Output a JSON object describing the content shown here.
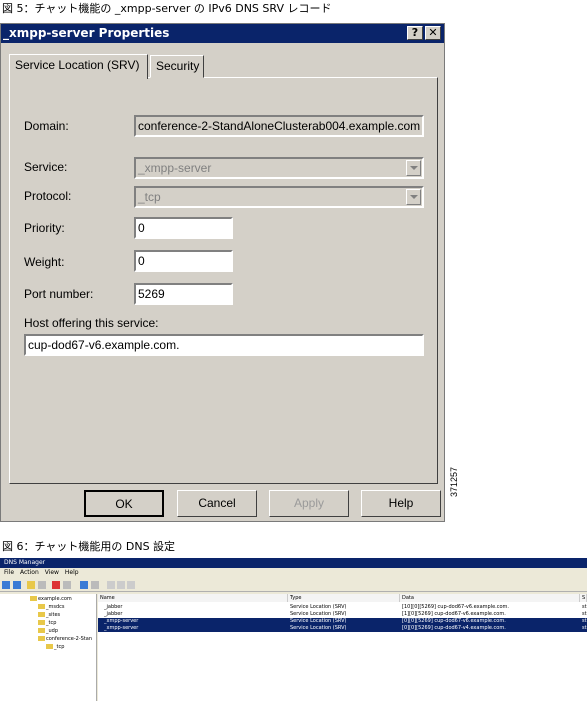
{
  "captions": {
    "fig5": "図 5：チャット機能の _xmpp-server の IPv6 DNS SRV レコード",
    "fig6": "図 6：チャット機能用の DNS 設定",
    "figure_id": "371257"
  },
  "dialog": {
    "title": "_xmpp-server Properties",
    "help_glyph": "?",
    "close_glyph": "✕",
    "tabs": [
      "Service Location (SRV)",
      "Security"
    ],
    "domain_label": "Domain:",
    "domain_value": "conference-2-StandAloneClusterab004.example.com",
    "service_label": "Service:",
    "service_value": "_xmpp-server",
    "protocol_label": "Protocol:",
    "protocol_value": "_tcp",
    "priority_label": "Priority:",
    "priority_value": "0",
    "weight_label": "Weight:",
    "weight_value": "0",
    "port_label": "Port number:",
    "port_value": "5269",
    "host_label": "Host offering this service:",
    "host_value": "cup-dod67-v6.example.com.",
    "buttons": {
      "ok": "OK",
      "cancel": "Cancel",
      "apply": "Apply",
      "help": "Help"
    }
  },
  "dns_manager": {
    "title": "DNS Manager",
    "menu": [
      "File",
      "Action",
      "View",
      "Help"
    ],
    "tree": [
      "example.com",
      "_msdcs",
      "_sites",
      "_tcp",
      "_udp",
      "conference-2-Stan",
      "_tcp"
    ],
    "columns": [
      "Name",
      "Type",
      "Data",
      "S"
    ],
    "rows": [
      {
        "name": "_jabber",
        "type": "Service Location (SRV)",
        "data": "[10][0][5269] cup-dod67-v6.example.com.",
        "s": "st",
        "selected": false
      },
      {
        "name": "_jabber",
        "type": "Service Location (SRV)",
        "data": "[1][0][5269] cup-dod67-v6.example.com.",
        "s": "st",
        "selected": false
      },
      {
        "name": "_xmpp-server",
        "type": "Service Location (SRV)",
        "data": "[0][0][5269] cup-dod67-v6.example.com.",
        "s": "st",
        "selected": true
      },
      {
        "name": "_xmpp-server",
        "type": "Service Location (SRV)",
        "data": "[0][0][5269] cup-dod67-v4.example.com.",
        "s": "st",
        "selected": true
      }
    ]
  },
  "colors": {
    "titlebar": "#0a246a",
    "dialog_bg": "#d4d0c8",
    "selected_row": "#0a246a"
  }
}
